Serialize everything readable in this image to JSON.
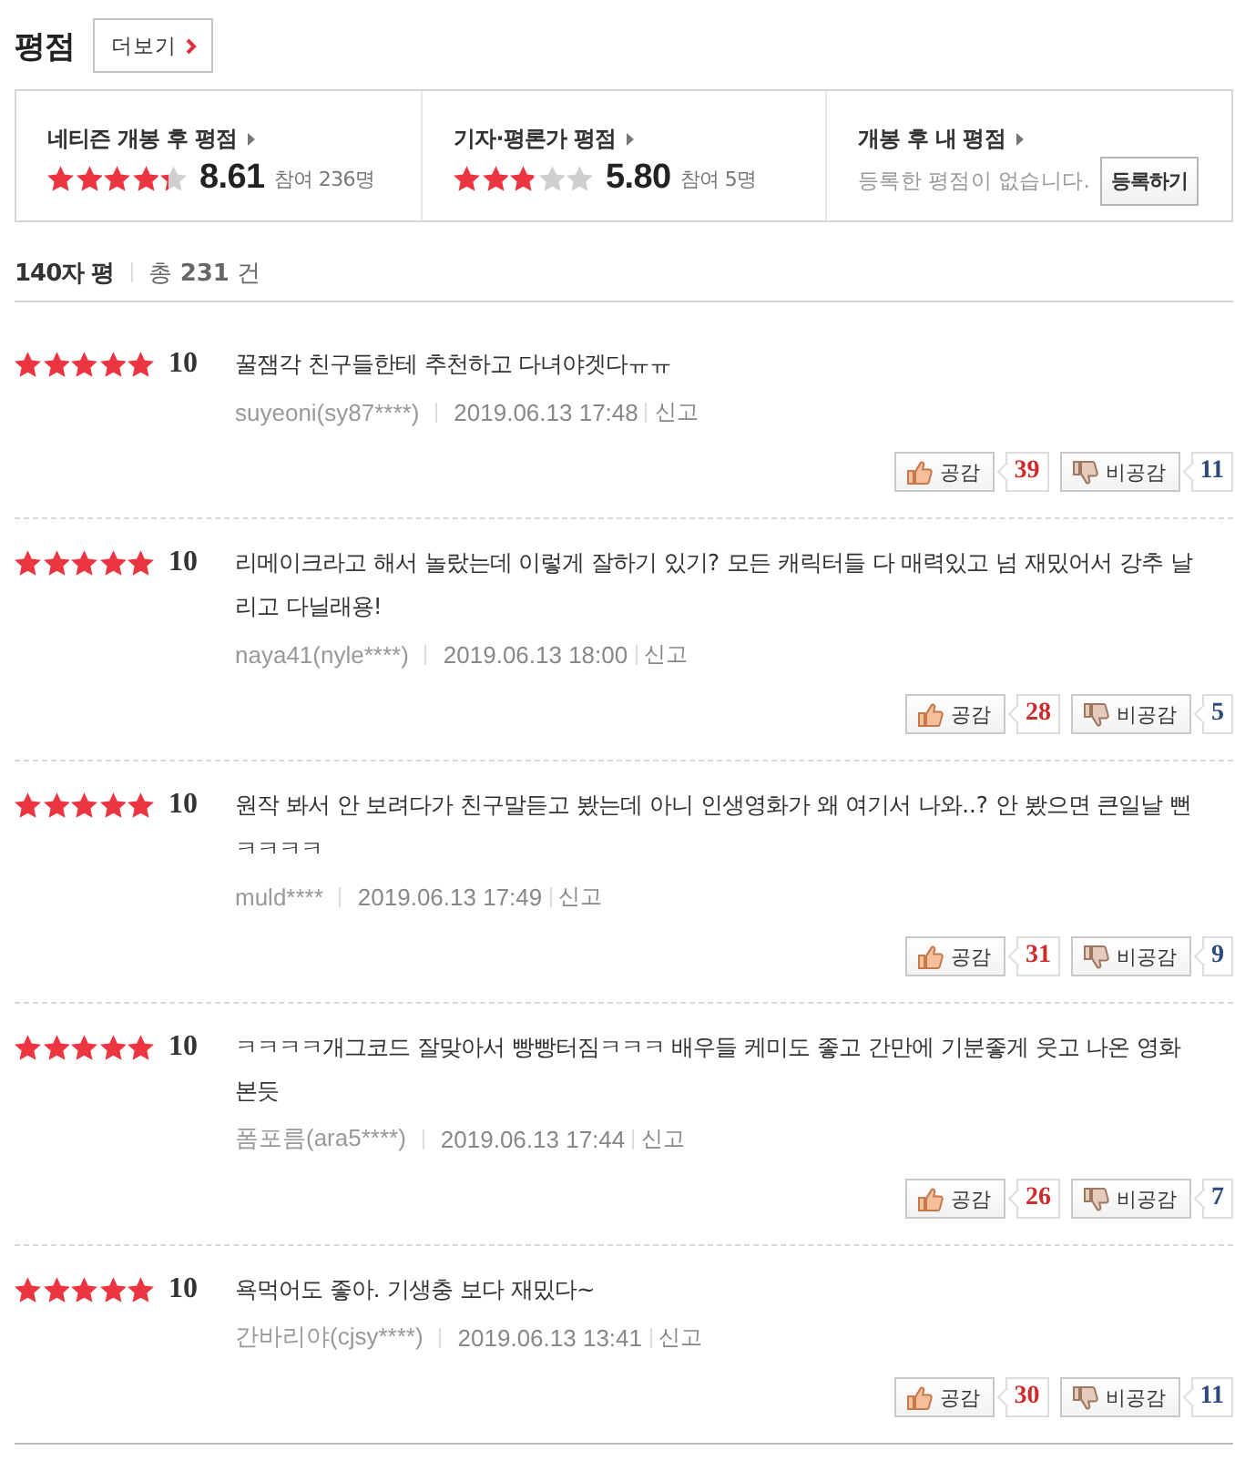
{
  "header": {
    "title": "평점",
    "more_button": "더보기"
  },
  "summary": [
    {
      "kind": "score",
      "label": "네티즌 개봉 후 평점",
      "stars": 4.3,
      "score": "8.61",
      "participants": "참여 236명"
    },
    {
      "kind": "score",
      "label": "기자·평론가 평점",
      "stars": 2.9,
      "score": "5.80",
      "participants": "참여 5명"
    },
    {
      "kind": "mine",
      "label": "개봉 후 내 평점",
      "message": "등록한 평점이 없습니다.",
      "button": "등록하기"
    }
  ],
  "list_header": {
    "title": "140자 평",
    "total": "총 **231** 건"
  },
  "reviews": [
    {
      "stars": 5,
      "score": "10",
      "text": "꿀잼각 친구들한테 추천하고 다녀야겟다ㅠㅠ",
      "author": "suyeoni(sy87****)",
      "date": "2019.06.13 17:48",
      "report": "신고",
      "like_label": "공감",
      "likes": "39",
      "dislike_label": "비공감",
      "dislikes": "11"
    },
    {
      "stars": 5,
      "score": "10",
      "text": "리메이크라고 해서 놀랐는데 이렇게 잘하기 있기? 모든 캐릭터들 다 매력있고 넘 재밌어서 강추 날리고 다닐래용!",
      "author": "naya41(nyle****)",
      "date": "2019.06.13 18:00",
      "report": "신고",
      "like_label": "공감",
      "likes": "28",
      "dislike_label": "비공감",
      "dislikes": "5"
    },
    {
      "stars": 5,
      "score": "10",
      "text": "원작 봐서 안 보려다가 친구말듣고 봤는데 아니 인생영화가 왜 여기서 나와..? 안 봤으면 큰일날 뻔ㅋㅋㅋㅋ",
      "author": "muld****",
      "date": "2019.06.13 17:49",
      "report": "신고",
      "like_label": "공감",
      "likes": "31",
      "dislike_label": "비공감",
      "dislikes": "9"
    },
    {
      "stars": 5,
      "score": "10",
      "text": "ㅋㅋㅋㅋ개그코드 잘맞아서 빵빵터짐ㅋㅋㅋ 배우들 케미도 좋고 간만에 기분좋게 웃고 나온 영화 본듯",
      "author": "폼포름(ara5****)",
      "date": "2019.06.13 17:44",
      "report": "신고",
      "like_label": "공감",
      "likes": "26",
      "dislike_label": "비공감",
      "dislikes": "7"
    },
    {
      "stars": 5,
      "score": "10",
      "text": "욕먹어도 좋아. 기생충 보다 재밌다~",
      "author": "간바리야(cjsy****)",
      "date": "2019.06.13 13:41",
      "report": "신고",
      "like_label": "공감",
      "likes": "30",
      "dislike_label": "비공감",
      "dislikes": "11"
    }
  ]
}
